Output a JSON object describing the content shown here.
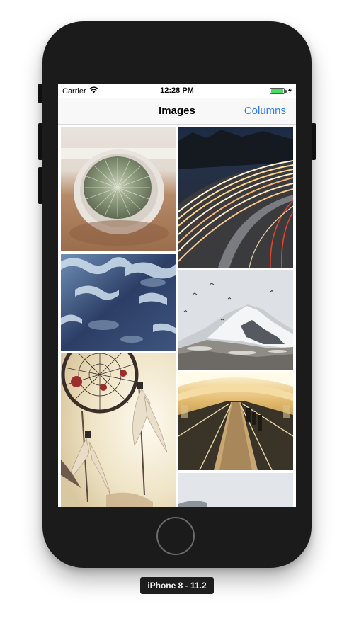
{
  "status_bar": {
    "carrier": "Carrier",
    "time": "12:28 PM",
    "battery_color": "#4cd964"
  },
  "nav_bar": {
    "title": "Images",
    "right_action": "Columns",
    "accent_color": "#2f7cf6"
  },
  "gallery": {
    "left_column": [
      "cactus",
      "water-surface",
      "dream-catcher"
    ],
    "right_column": [
      "light-trails-road",
      "snowy-mountain",
      "escalator-tunnel",
      "sky-partial"
    ]
  },
  "device": {
    "label": "iPhone 8 - 11.2"
  }
}
